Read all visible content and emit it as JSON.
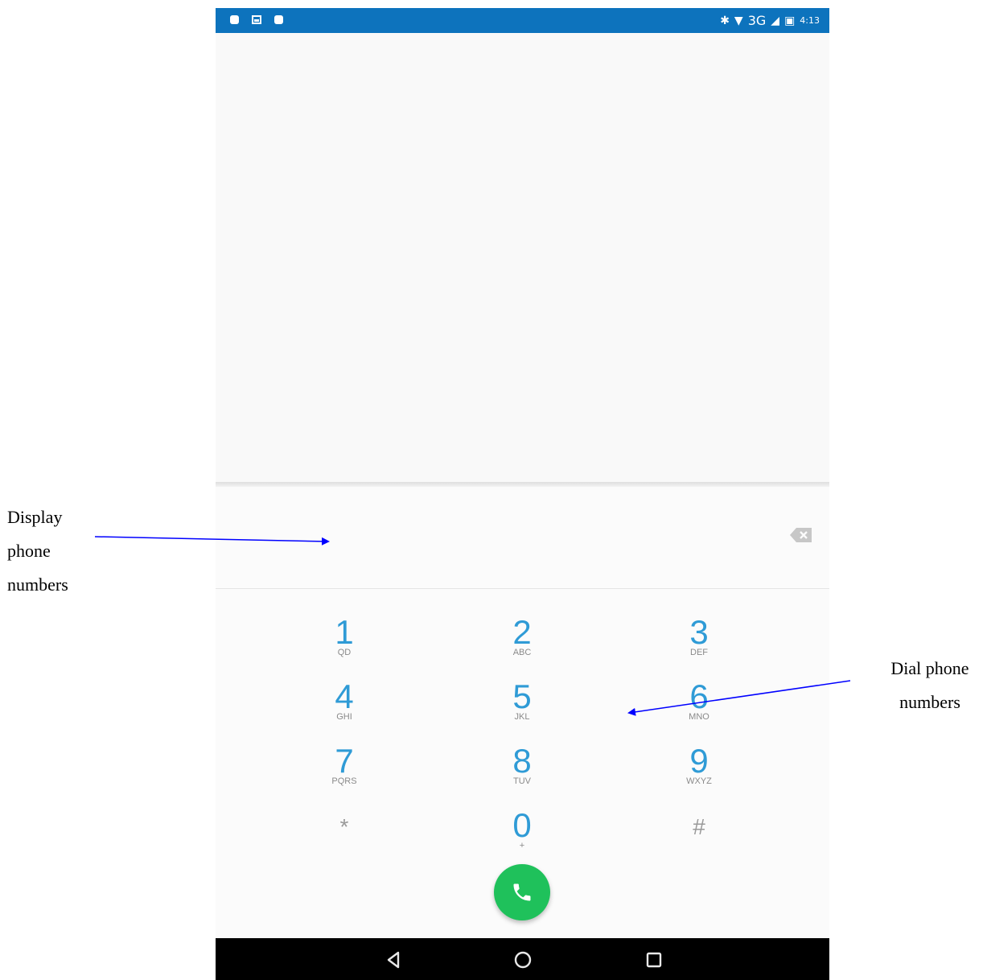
{
  "status_bar": {
    "network": "3G",
    "time": "4:13",
    "color": "#0d73bd"
  },
  "keypad": {
    "keys": [
      {
        "digit": "1",
        "letters": "QD"
      },
      {
        "digit": "2",
        "letters": "ABC"
      },
      {
        "digit": "3",
        "letters": "DEF"
      },
      {
        "digit": "4",
        "letters": "GHI"
      },
      {
        "digit": "5",
        "letters": "JKL"
      },
      {
        "digit": "6",
        "letters": "MNO"
      },
      {
        "digit": "7",
        "letters": "PQRS"
      },
      {
        "digit": "8",
        "letters": "TUV"
      },
      {
        "digit": "9",
        "letters": "WXYZ"
      },
      {
        "digit": "*",
        "letters": ""
      },
      {
        "digit": "0",
        "letters": "+"
      },
      {
        "digit": "#",
        "letters": ""
      }
    ],
    "digit_color": "#2f9bd6",
    "call_button_color": "#1fc15b"
  },
  "icons": {
    "backspace": "backspace-icon",
    "call": "phone-icon",
    "nav_back": "back-triangle-icon",
    "nav_home": "home-circle-icon",
    "nav_recents": "recents-square-icon"
  },
  "annotations": {
    "display_label_line1": "Display",
    "display_label_line2": "phone",
    "display_label_line3": "numbers",
    "dial_label_line1": "Dial phone",
    "dial_label_line2": "numbers",
    "arrow_color": "#0000ff"
  }
}
